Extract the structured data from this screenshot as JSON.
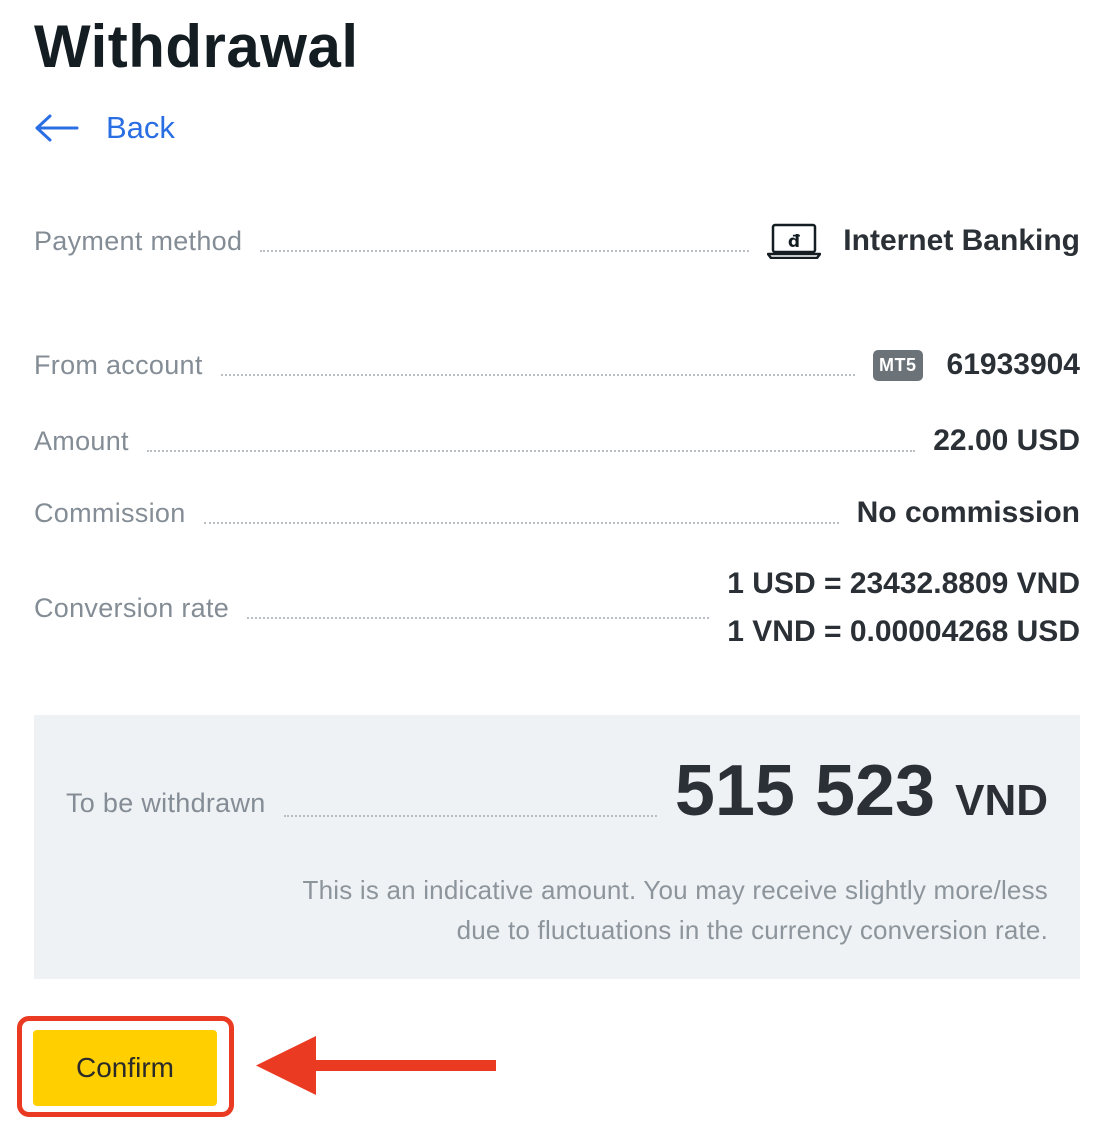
{
  "page": {
    "title": "Withdrawal"
  },
  "nav": {
    "back_label": "Back"
  },
  "details": {
    "payment_method": {
      "label": "Payment method",
      "value": "Internet Banking",
      "icon": "laptop-icon"
    },
    "from_account": {
      "label": "From account",
      "badge": "MT5",
      "value": "61933904"
    },
    "amount": {
      "label": "Amount",
      "value": "22.00 USD"
    },
    "commission": {
      "label": "Commission",
      "value": "No commission"
    },
    "conversion_rate": {
      "label": "Conversion rate",
      "line1": "1 USD = 23432.8809 VND",
      "line2": "1 VND = 0.00004268 USD"
    }
  },
  "summary": {
    "label": "To be withdrawn",
    "amount": "515 523",
    "currency": "VND",
    "disclaimer_line1": "This is an indicative amount. You may receive slightly more/less",
    "disclaimer_line2": "due to fluctuations in the currency conversion rate."
  },
  "actions": {
    "confirm_label": "Confirm"
  },
  "colors": {
    "accent_link": "#2a6ee4",
    "confirm_button": "#ffcf00",
    "highlight": "#ea3a22",
    "summary_bg": "#eff2f5"
  }
}
